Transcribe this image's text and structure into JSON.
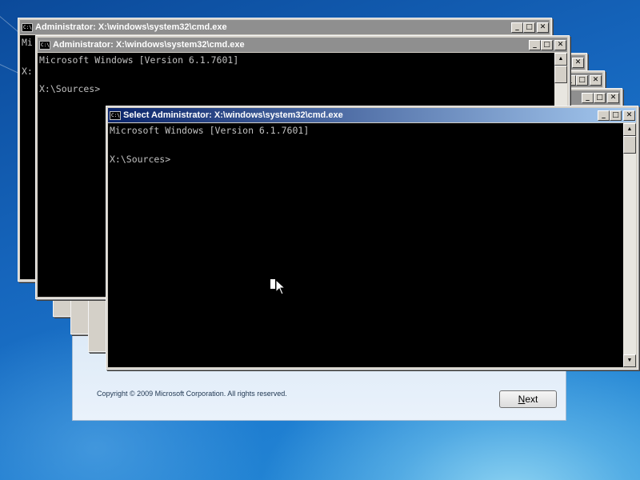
{
  "desktop": {
    "setup_dialog": {
      "copyright": "Copyright © 2009 Microsoft Corporation. All rights reserved.",
      "next_button": {
        "prefix": "",
        "underlined": "N",
        "rest": "ext"
      }
    }
  },
  "windows": [
    {
      "title": "Administrator: X:\\windows\\system32\\cmd.exe",
      "lines": [
        "Mi",
        "",
        "X:"
      ]
    },
    {
      "title": "Administrator: X:\\windows\\system32\\cmd.exe",
      "lines": [
        "Microsoft Windows [Version 6.1.7601]",
        "",
        "X:\\Sources>"
      ]
    },
    {
      "title": "Select Administrator: X:\\windows\\system32\\cmd.exe",
      "lines": [
        "Microsoft Windows [Version 6.1.7601]",
        "",
        "X:\\Sources>"
      ]
    }
  ],
  "icons": {
    "app_icon": "C:\\",
    "minimize": "_",
    "maximize": "□",
    "close": "✕",
    "scroll_up": "▲",
    "scroll_down": "▼"
  },
  "colors": {
    "title_active": "#0a246a",
    "console_bg": "#000000",
    "console_text": "#c0c0c0"
  }
}
